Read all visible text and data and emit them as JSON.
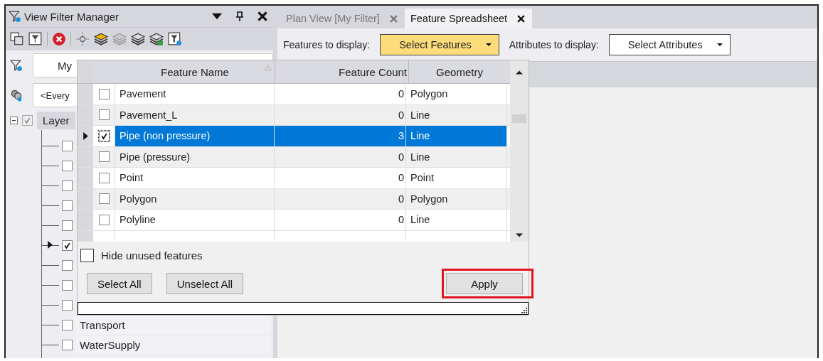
{
  "filter_panel": {
    "title": "View Filter Manager",
    "filter_field": {
      "value": "My"
    },
    "scope_field": {
      "value": "<Every"
    },
    "tree": {
      "label": "Layer",
      "checked": true,
      "expanded": true,
      "children": [
        {
          "checked": false,
          "current": false
        },
        {
          "checked": false,
          "current": false
        },
        {
          "checked": false,
          "current": false
        },
        {
          "checked": false,
          "current": false
        },
        {
          "checked": false,
          "current": false
        },
        {
          "checked": true,
          "current": true
        },
        {
          "checked": false,
          "current": false
        },
        {
          "checked": false,
          "current": false
        },
        {
          "checked": false,
          "current": false
        },
        {
          "label": "Transport",
          "checked": false,
          "current": false
        },
        {
          "label": "WaterSupply",
          "checked": false,
          "current": false
        }
      ]
    }
  },
  "tabs": [
    {
      "label": "Plan View [My Filter]",
      "selected": false
    },
    {
      "label": "Feature Spreadsheet",
      "selected": true
    }
  ],
  "toolbar": {
    "features_label": "Features to display:",
    "features_dropdown": {
      "value": "Select Features",
      "open": true
    },
    "attributes_label": "Attributes to display:",
    "attributes_dropdown": {
      "value": "Select Attributes",
      "open": false
    }
  },
  "feature_popup": {
    "columns": [
      "Feature Name",
      "Feature Count",
      "Geometry"
    ],
    "rows": [
      {
        "name": "Pavement",
        "count": "0",
        "geometry": "Polygon",
        "checked": false,
        "selected": false
      },
      {
        "name": "Pavement_L",
        "count": "0",
        "geometry": "Line",
        "checked": false,
        "selected": false
      },
      {
        "name": "Pipe (non pressure)",
        "count": "3",
        "geometry": "Line",
        "checked": true,
        "selected": true
      },
      {
        "name": "Pipe (pressure)",
        "count": "0",
        "geometry": "Line",
        "checked": false,
        "selected": false
      },
      {
        "name": "Point",
        "count": "0",
        "geometry": "Point",
        "checked": false,
        "selected": false
      },
      {
        "name": "Polygon",
        "count": "0",
        "geometry": "Polygon",
        "checked": false,
        "selected": false
      },
      {
        "name": "Polyline",
        "count": "0",
        "geometry": "Line",
        "checked": false,
        "selected": false
      }
    ],
    "hide_unused": {
      "label": "Hide unused features",
      "checked": false
    },
    "buttons": [
      {
        "label": "Select All",
        "highlighted": false
      },
      {
        "label": "Unselect All",
        "highlighted": false
      },
      {
        "label": "Apply",
        "highlighted": true
      }
    ]
  }
}
